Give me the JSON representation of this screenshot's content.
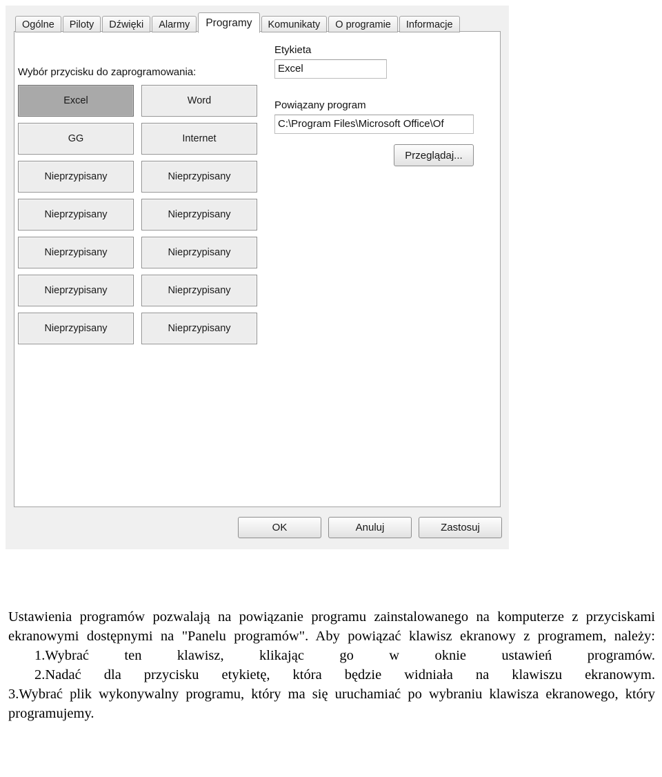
{
  "dialog": {
    "tabs": [
      {
        "label": "Ogólne",
        "active": false
      },
      {
        "label": "Piloty",
        "active": false
      },
      {
        "label": "Dźwięki",
        "active": false
      },
      {
        "label": "Alarmy",
        "active": false
      },
      {
        "label": "Programy",
        "active": true
      },
      {
        "label": "Komunikaty",
        "active": false
      },
      {
        "label": "O programie",
        "active": false
      },
      {
        "label": "Informacje",
        "active": false
      }
    ],
    "left_panel": {
      "section_label": "Wybór przycisku do zaprogramowania:",
      "buttons": [
        {
          "label": "Excel",
          "selected": true
        },
        {
          "label": "Word",
          "selected": false
        },
        {
          "label": "GG",
          "selected": false
        },
        {
          "label": "Internet",
          "selected": false
        },
        {
          "label": "Nieprzypisany",
          "selected": false
        },
        {
          "label": "Nieprzypisany",
          "selected": false
        },
        {
          "label": "Nieprzypisany",
          "selected": false
        },
        {
          "label": "Nieprzypisany",
          "selected": false
        },
        {
          "label": "Nieprzypisany",
          "selected": false
        },
        {
          "label": "Nieprzypisany",
          "selected": false
        },
        {
          "label": "Nieprzypisany",
          "selected": false
        },
        {
          "label": "Nieprzypisany",
          "selected": false
        },
        {
          "label": "Nieprzypisany",
          "selected": false
        },
        {
          "label": "Nieprzypisany",
          "selected": false
        }
      ]
    },
    "right_panel": {
      "label_caption": "Etykieta",
      "label_value": "Excel",
      "program_caption": "Powiązany program",
      "program_value": "C:\\Program Files\\Microsoft Office\\Of",
      "browse_label": "Przeglądaj..."
    },
    "footer": {
      "ok_label": "OK",
      "cancel_label": "Anuluj",
      "apply_label": "Zastosuj"
    },
    "colors": {
      "dialog_background": "#f0f0f0",
      "panel_background": "#ffffff",
      "button_face": "#ededed",
      "button_selected": "#a9a9a9",
      "border": "#8f8f8f"
    }
  },
  "caption": {
    "intro": "Ustawienia programów pozwalają na powiązanie programu zainstalowanego na komputerze z przyciskami ekranowymi dostępnymi na \"Panelu programów\". Aby powiązać klawisz ekranowy z programem, należy:",
    "steps": [
      "1.Wybrać ten klawisz, klikając go w oknie ustawień programów.",
      "2.Nadać dla przycisku etykietę, która będzie widniała na klawiszu ekranowym.",
      "3.Wybrać plik wykonywalny programu, który ma się uruchamiać po wybraniu klawisza ekranowego, który programujemy."
    ]
  }
}
